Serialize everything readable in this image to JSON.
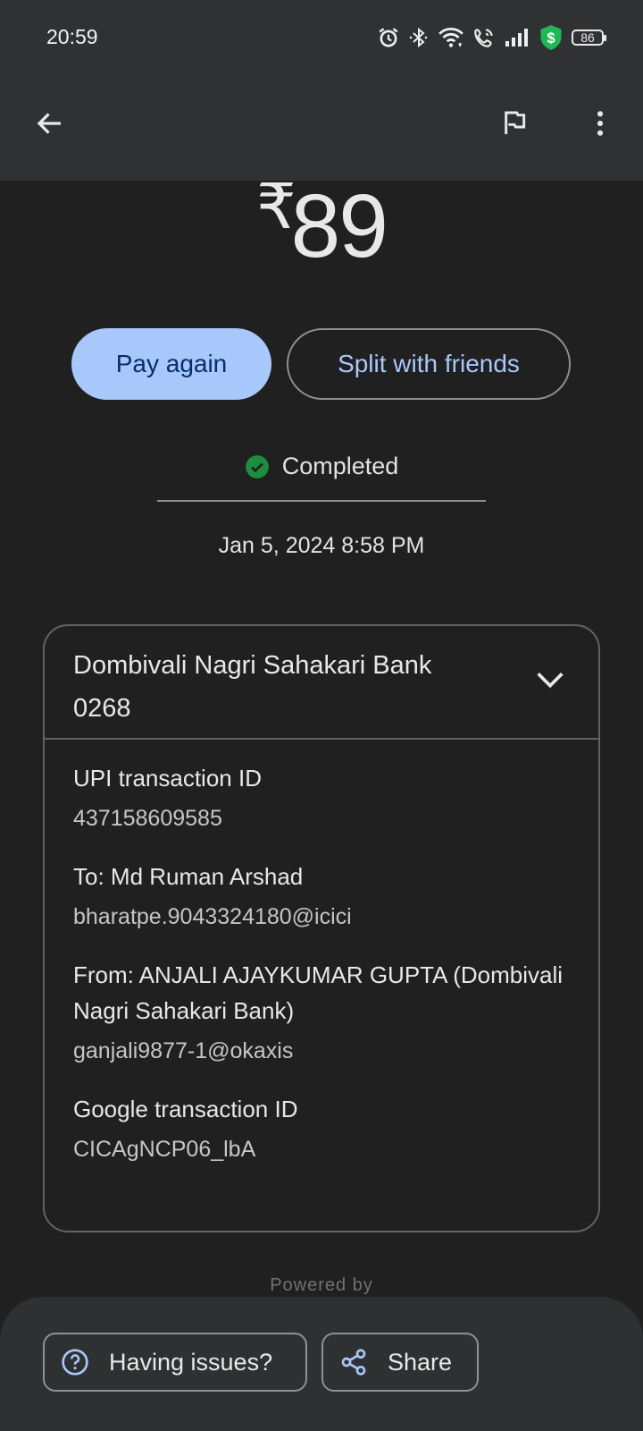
{
  "status_bar": {
    "time": "20:59",
    "battery": "86",
    "icons": [
      "alarm-icon",
      "bluetooth-icon",
      "wifi-icon",
      "wifi-calling-icon",
      "signal-icon",
      "security-shield-icon",
      "battery-icon"
    ]
  },
  "app_bar": {
    "icons": [
      "back-arrow-icon",
      "flag-icon",
      "more-vert-icon"
    ]
  },
  "transaction": {
    "currency": "₹",
    "amount": "89",
    "status": "Completed",
    "datetime": "Jan 5, 2024 8:58 PM"
  },
  "actions": {
    "pay_again": "Pay again",
    "split": "Split with friends"
  },
  "card": {
    "title_line1": "Dombivali Nagri Sahakari Bank",
    "title_line2": "0268",
    "fields": [
      {
        "label": "UPI transaction ID",
        "value": "437158609585"
      },
      {
        "label": "To: Md Ruman Arshad",
        "value": "bharatpe.9043324180@icici"
      },
      {
        "label": "From: ANJALI AJAYKUMAR GUPTA (Dombivali Nagri Sahakari Bank)",
        "value": "ganjali9877-1@okaxis"
      },
      {
        "label": "Google transaction ID",
        "value": "CICAgNCP06_lbA"
      }
    ]
  },
  "footer": {
    "powered_by": "Powered by",
    "having_issues": "Having issues?",
    "share": "Share"
  },
  "colors": {
    "background": "#202020",
    "app_bar": "#303133",
    "accent": "#a8c7fa",
    "success": "#1e8e3e",
    "shield": "#1db954"
  }
}
